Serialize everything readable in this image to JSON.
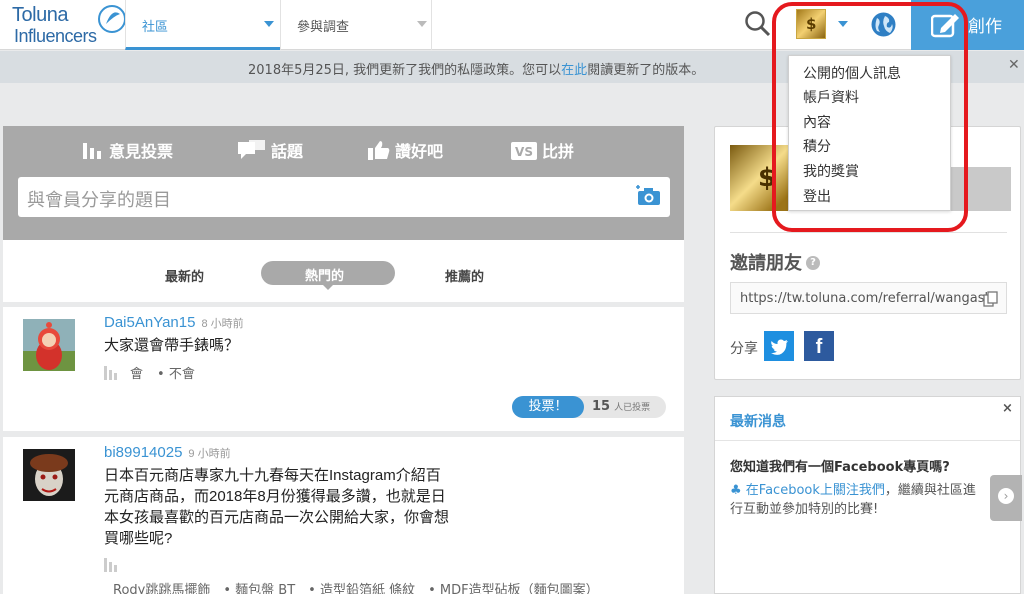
{
  "header": {
    "logo_line1": "Toluna",
    "logo_line2": "Influencers",
    "tabs": [
      {
        "label": "社區"
      },
      {
        "label": "參與調查"
      }
    ],
    "create_label": "創作"
  },
  "notice": {
    "text_before": "2018年5月25日, 我們更新了我們的私隱政策。您可以",
    "link": "在此",
    "text_after": "閱讀更新了的版本。",
    "close": "✕"
  },
  "composer": {
    "tabs": [
      {
        "label": "意見投票"
      },
      {
        "label": "話題"
      },
      {
        "label": "讚好吧"
      },
      {
        "label": "比拼",
        "badge": "VS"
      }
    ],
    "placeholder": "與會員分享的題目"
  },
  "filters": [
    {
      "label": "最新的"
    },
    {
      "label": "熱門的"
    },
    {
      "label": "推薦的"
    }
  ],
  "posts": [
    {
      "user": "Dai5AnYan15",
      "time": "8 小時前",
      "question": "大家還會帶手錶嗎？",
      "options": [
        "會",
        "• 不會"
      ],
      "vote_label": "投票！",
      "vote_count": "15",
      "vote_suffix": "人已投票"
    },
    {
      "user": "bi89914025",
      "time": "9 小時前",
      "question_lines": [
        "日本百元商店專家九十九春每天在Instagram介紹百",
        "元商店商品，而2018年8月份獲得最多讚，也就是日",
        "本女孩最喜歡的百元店商品一次公開給大家，你會想",
        "買哪些呢?"
      ],
      "options_text": "Rody跳跳馬擺飾　• 麵包盤 BT　• 造型鉛箔紙 條紋　• MDF造型砧板（麵包圖案）"
    }
  ],
  "sidebar": {
    "invite_title": "邀請朋友",
    "invite_help": "?",
    "referral_url": "https://tw.toluna.com/referral/wangash",
    "share_label": "分享",
    "news": {
      "title": "最新消息",
      "close": "×",
      "headline": "您知道我們有一個Facebook專頁嗎?",
      "bullet": "♣",
      "link": "在Facebook上關注我們",
      "body": "，繼續與社區進行互動並參加特別的比賽!"
    }
  },
  "dropdown": {
    "items": [
      "公開的個人訊息",
      "帳戶資料",
      "內容",
      "積分",
      "我的獎賞",
      "登出"
    ]
  },
  "colors": {
    "accent": "#3a93d3",
    "create": "#4aa0db",
    "highlight": "#e5191e"
  }
}
